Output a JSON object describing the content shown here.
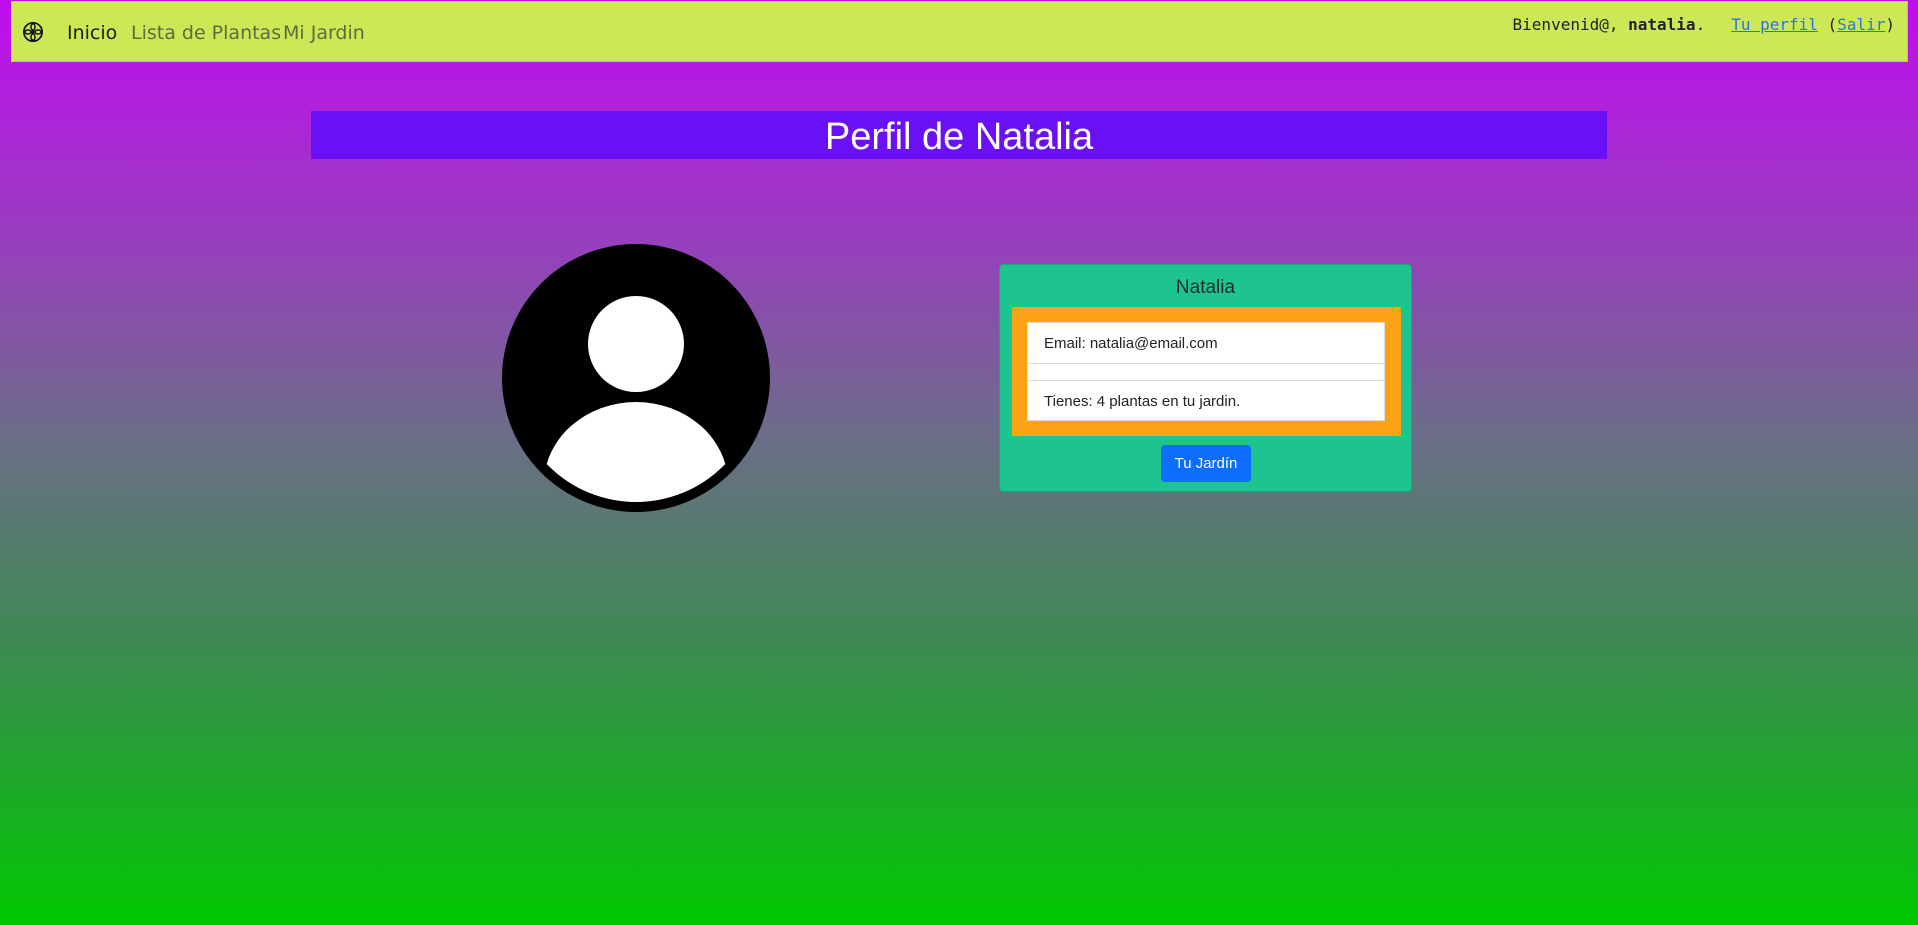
{
  "navbar": {
    "brand_icon": "flower-icon",
    "links": [
      {
        "label": "Inicio",
        "active": true
      },
      {
        "label": "Lista de Plantas",
        "active": false
      },
      {
        "label": "Mi Jardin",
        "active": false
      }
    ],
    "greeting_prefix": "Bienvenid@, ",
    "username": "natalia",
    "greeting_suffix": ".",
    "profile_link": "Tu perfil",
    "logout_open": "(",
    "logout_link": "Salir",
    "logout_close": ")"
  },
  "page": {
    "title": "Perfil de Natalia",
    "avatar_icon": "user-avatar-icon"
  },
  "card": {
    "title": "Natalia",
    "email_line": "Email: natalia@email.com",
    "plants_line": "Tienes: 4 plantas en tu jardin.",
    "button_label": "Tu Jardín"
  },
  "colors": {
    "navbar_bg": "#cde856",
    "title_bg": "#6a10f5",
    "card_bg": "#1ec48f",
    "card_inner_bg": "#fba314",
    "button_bg": "#0d6efd"
  }
}
